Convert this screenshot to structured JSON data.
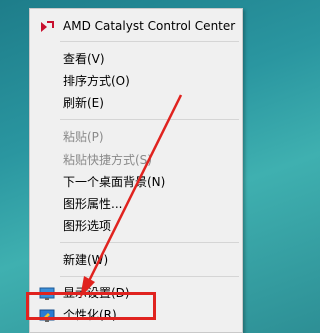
{
  "menu": {
    "header": "AMD Catalyst Control Center",
    "view": "查看(V)",
    "sort": "排序方式(O)",
    "refresh": "刷新(E)",
    "paste": "粘贴(P)",
    "paste_shortcut": "粘贴快捷方式(S)",
    "next_bg": "下一个桌面背景(N)",
    "graphics_props": "图形属性...",
    "graphics_options": "图形选项",
    "new": "新建(W)",
    "display": "显示设置(D)",
    "personalize": "个性化(R)"
  },
  "colors": {
    "annotation": "#e0231f",
    "desktop": "#2a96a0"
  }
}
